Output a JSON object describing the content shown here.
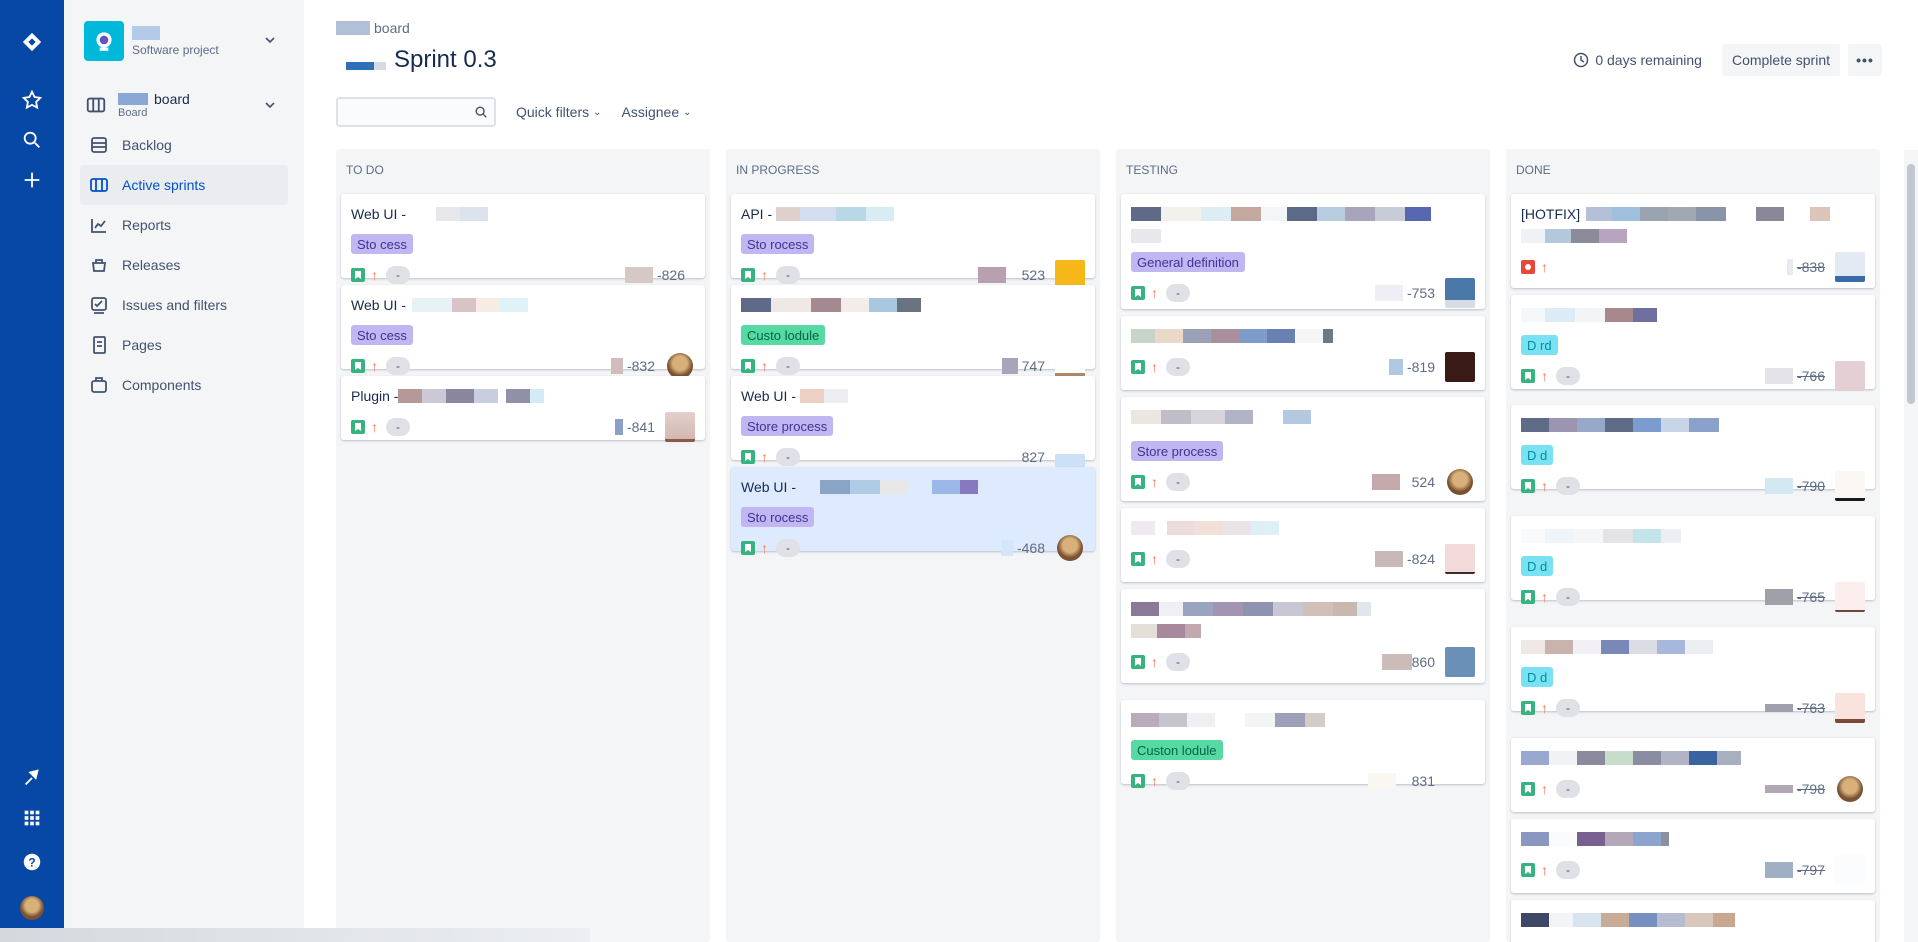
{
  "sidebar": {
    "project_type": "Software project",
    "board_name": "board",
    "board_sub": "Board",
    "items": [
      {
        "label": "Backlog",
        "icon": "backlog-icon"
      },
      {
        "label": "Active sprints",
        "icon": "board-icon"
      },
      {
        "label": "Reports",
        "icon": "reports-icon"
      },
      {
        "label": "Releases",
        "icon": "releases-icon"
      },
      {
        "label": "Issues and filters",
        "icon": "issues-icon"
      },
      {
        "label": "Pages",
        "icon": "pages-icon"
      },
      {
        "label": "Components",
        "icon": "components-icon"
      }
    ]
  },
  "header": {
    "breadcrumb": "board",
    "title": "Sprint 0.3",
    "days_remaining": "0 days remaining",
    "complete_label": "Complete sprint",
    "more_label": "•••"
  },
  "toolbar": {
    "search_placeholder": "",
    "quick_filters": "Quick filters",
    "assignee": "Assignee"
  },
  "columns": [
    {
      "name": "TO DO"
    },
    {
      "name": "IN PROGRESS"
    },
    {
      "name": "TESTING"
    },
    {
      "name": "DONE"
    }
  ],
  "cards": {
    "todo": [
      {
        "title": "Web UI -",
        "epic": "Sto cess",
        "key": "-826",
        "estimate": "-"
      },
      {
        "title": "Web UI -",
        "epic": "Sto cess",
        "key": "-832",
        "estimate": "-"
      },
      {
        "title": "Plugin -",
        "key": "-841",
        "estimate": "-"
      }
    ],
    "inprogress": [
      {
        "title": "API -",
        "epic": "Sto rocess",
        "key": "523",
        "estimate": "-"
      },
      {
        "title": "",
        "epic": "Custo lodule",
        "key": "747",
        "estimate": "-"
      },
      {
        "title": "Web UI -",
        "epic": "Store process",
        "key": "827",
        "estimate": "-"
      },
      {
        "title": "Web UI -",
        "epic": "Sto rocess",
        "key": "-468",
        "estimate": "-"
      }
    ],
    "testing": [
      {
        "epic": "General definition",
        "key": "-753",
        "estimate": "-"
      },
      {
        "key": "-819",
        "estimate": "-"
      },
      {
        "epic": "Store process",
        "key": "524",
        "estimate": "-"
      },
      {
        "key": "-824",
        "estimate": "-"
      },
      {
        "key": "860",
        "estimate": "-"
      },
      {
        "epic": "Custon lodule",
        "key": "831",
        "estimate": "-"
      }
    ],
    "done": [
      {
        "title": "[HOTFIX]",
        "key": "-838",
        "estimate": "-"
      },
      {
        "epic": "D rd",
        "key": "-766",
        "estimate": "-"
      },
      {
        "epic": "D d",
        "key": "-790",
        "estimate": "-"
      },
      {
        "epic": "D d",
        "key": "-765",
        "estimate": "-"
      },
      {
        "epic": "D d",
        "key": "-763",
        "estimate": "-"
      },
      {
        "key": "-798",
        "estimate": "-"
      },
      {
        "key": "-797",
        "estimate": "-"
      }
    ]
  },
  "colors": {
    "nav": "#0747a6",
    "sidebar": "#f4f5f7",
    "epic_purple": "#c0b6f2",
    "epic_green": "#57d9a3",
    "epic_teal": "#79e2f2",
    "story": "#36b37e",
    "bug": "#e5493a"
  }
}
